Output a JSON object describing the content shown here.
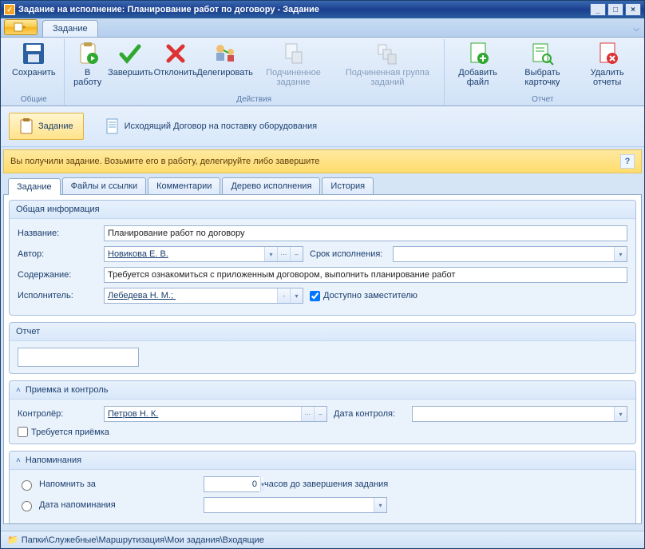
{
  "title": "Задание на исполнение: Планирование работ по договору - Задание",
  "ribbon": {
    "tab": "Задание",
    "groups": {
      "common": {
        "label": "Общие",
        "save": "Сохранить"
      },
      "actions": {
        "label": "Действия",
        "to_work": "В работу",
        "complete": "Завершить",
        "reject": "Отклонить",
        "delegate": "Делегировать",
        "sub_task": "Подчиненное задание",
        "sub_group": "Подчиненная группа заданий"
      },
      "report": {
        "label": "Отчет",
        "add_file": "Добавить файл",
        "choose_card": "Выбрать карточку",
        "delete_reports": "Удалить отчеты"
      }
    }
  },
  "doc_band": {
    "primary": "Задание",
    "secondary": "Исходящий Договор на поставку оборудования"
  },
  "notice": "Вы получили задание. Возьмите его в работу, делегируйте либо завершите",
  "tabs": [
    "Задание",
    "Файлы и ссылки",
    "Комментарии",
    "Дерево исполнения",
    "История"
  ],
  "general": {
    "header": "Общая информация",
    "name_label": "Название:",
    "name_value": "Планирование работ по договору",
    "author_label": "Автор:",
    "author_value": "Новикова Е. В.",
    "deadline_label": "Срок исполнения:",
    "content_label": "Содержание:",
    "content_value": "Требуется ознакомиться с приложенным договором, выполнить планирование работ",
    "executor_label": "Исполнитель:",
    "executor_value": "Лебедева Н. М.; ",
    "deputy_label": "Доступно заместителю",
    "deputy_checked": true
  },
  "report": {
    "header": "Отчет",
    "value": ""
  },
  "control": {
    "header": "Приемка и контроль",
    "controller_label": "Контролёр:",
    "controller_value": "Петров Н. К.",
    "control_date_label": "Дата контроля:",
    "needs_acceptance_label": "Требуется приёмка"
  },
  "reminder": {
    "header": "Напоминания",
    "remind_before_label": "Напомнить за",
    "hours_value": "0",
    "hours_suffix": "часов до завершения задания",
    "remind_date_label": "Дата напоминания"
  },
  "statusbar": "Папки\\Служебные\\Маршрутизация\\Мои задания\\Входящие"
}
